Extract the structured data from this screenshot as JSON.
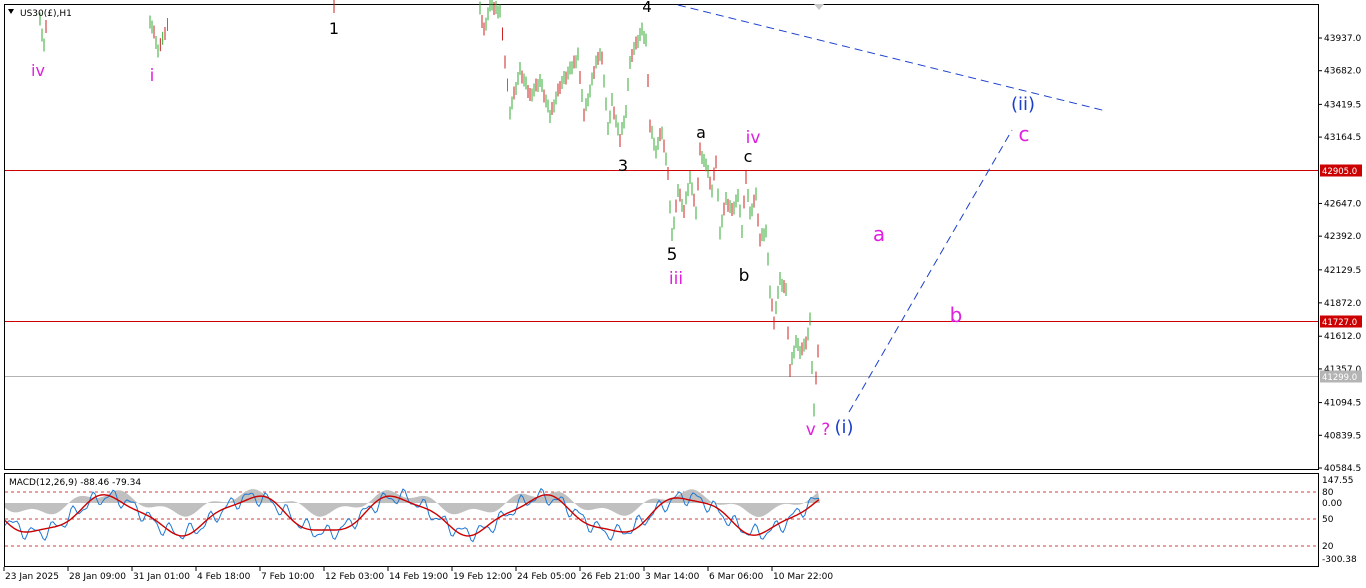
{
  "chart_data": {
    "type": "line",
    "symbol_label": "US30(£),H1",
    "indicator_label": "MACD(12,26,9) -88.46 -79.34",
    "price_axis": {
      "ticks": [
        "43937.0",
        "43682.0",
        "43419.5",
        "43164.5",
        "42905.0",
        "42647.0",
        "42392.0",
        "42129.5",
        "41872.0",
        "41727.0",
        "41612.0",
        "41357.0",
        "41299.0",
        "41094.5",
        "40839.5",
        "40584.5"
      ],
      "range": [
        40584.5,
        44200
      ]
    },
    "macd_axis": {
      "ticks": [
        "147.55",
        "80",
        "0.00",
        "50",
        "20",
        "-300.38"
      ]
    },
    "time_axis": {
      "ticks": [
        "23 Jan 2025",
        "28 Jan 09:00",
        "31 Jan 01:00",
        "4 Feb 18:00",
        "7 Feb 10:00",
        "12 Feb 03:00",
        "14 Feb 19:00",
        "19 Feb 12:00",
        "24 Feb 05:00",
        "26 Feb 21:00",
        "3 Mar 14:00",
        "6 Mar 06:00",
        "10 Mar 22:00"
      ]
    },
    "horizontal_levels": [
      {
        "price": 42905.0,
        "label": "42905.0",
        "color": "#cc0000"
      },
      {
        "price": 41727.0,
        "label": "41727.0",
        "color": "#cc0000"
      },
      {
        "price": 41299.0,
        "label": "41299.0",
        "color": "#b4b4b4"
      }
    ],
    "colors": {
      "bull": "#33aa33",
      "bear": "#cc2222",
      "projection": "#1a3fcc",
      "magenta": "#e020e0",
      "macd_hist": "#c0c0c0",
      "macd_line": "#1e78d2",
      "signal_line": "#cc0000"
    },
    "wave_labels": [
      {
        "text": "iv",
        "color": "#e020e0"
      },
      {
        "text": "i",
        "color": "#e020e0"
      },
      {
        "text": "1",
        "color": "#000000"
      },
      {
        "text": "4",
        "color": "#000000"
      },
      {
        "text": "3",
        "color": "#000000"
      },
      {
        "text": "a",
        "color": "#000000"
      },
      {
        "text": "iv",
        "color": "#e020e0"
      },
      {
        "text": "c",
        "color": "#000000"
      },
      {
        "text": "5",
        "color": "#000000"
      },
      {
        "text": "iii",
        "color": "#e020e0"
      },
      {
        "text": "b",
        "color": "#000000"
      },
      {
        "text": "v ?",
        "color": "#e020e0"
      },
      {
        "text": "(i)",
        "color": "#1a3fcc"
      },
      {
        "text": "(ii)",
        "color": "#1a3fcc"
      },
      {
        "text": "c",
        "color": "#e020e0"
      },
      {
        "text": "a",
        "color": "#e020e0"
      },
      {
        "text": "b",
        "color": "#e020e0"
      }
    ]
  }
}
